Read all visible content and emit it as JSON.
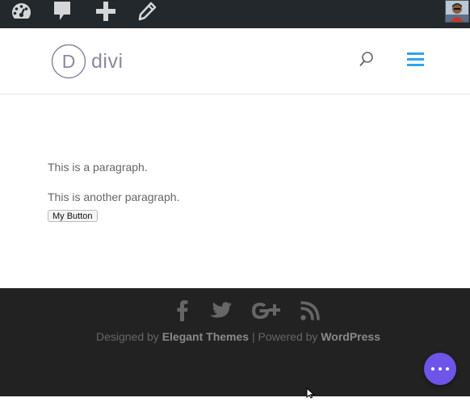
{
  "admin_bar": {
    "icons": [
      "dashboard-icon",
      "comments-icon",
      "new-content-icon",
      "edit-icon"
    ]
  },
  "header": {
    "logo_letter": "D",
    "logo_text": "divi"
  },
  "content": {
    "paragraph_1": "This is a paragraph.",
    "paragraph_2": "This is another paragraph.",
    "button_label": "My Button"
  },
  "footer": {
    "social_icons": [
      "facebook-icon",
      "twitter-icon",
      "google-plus-icon",
      "rss-icon"
    ],
    "credits_prefix": "Designed by",
    "credits_theme": "Elegant Themes",
    "credits_separator": "| Powered by",
    "credits_platform": "WordPress"
  },
  "colors": {
    "admin_bar_bg": "#23282d",
    "accent": "#2ea3f2",
    "footer_bg": "#222222",
    "fab": "#6e54e8"
  }
}
